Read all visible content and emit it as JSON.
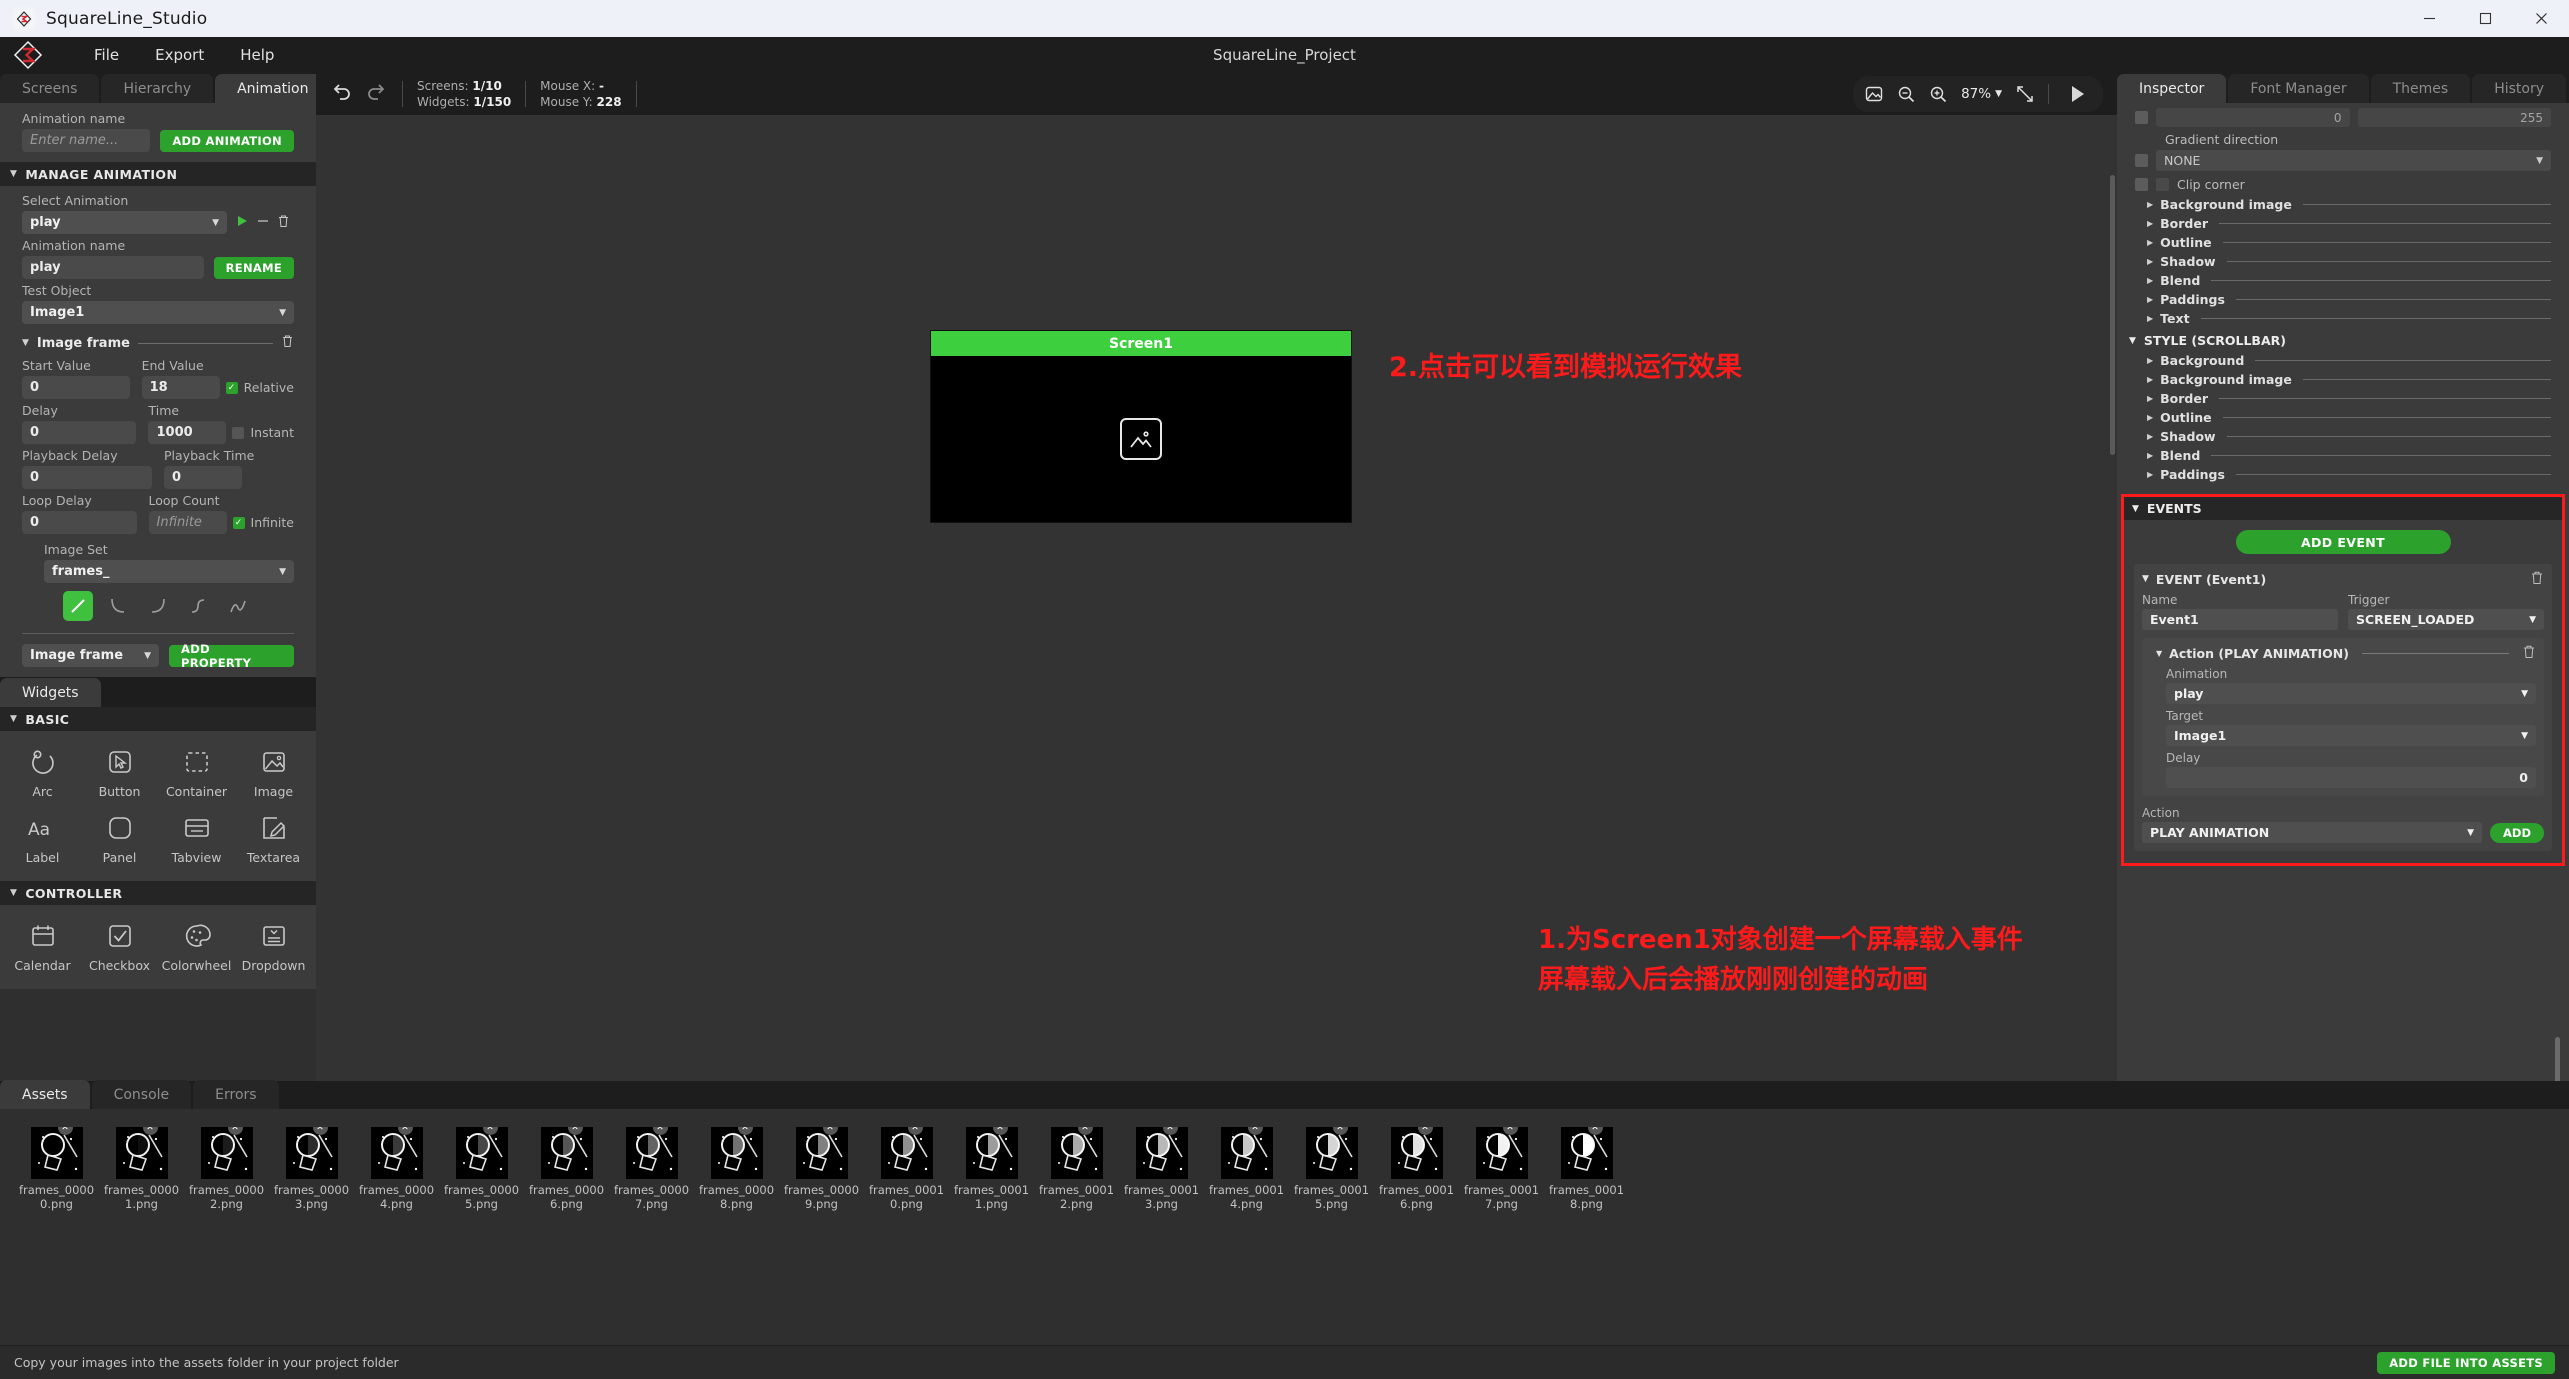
{
  "os": {
    "title": "SquareLine_Studio",
    "minimize": "─",
    "maximize": "❐",
    "close": "✕"
  },
  "menubar": {
    "items": [
      "File",
      "Export",
      "Help"
    ],
    "project_title": "SquareLine_Project"
  },
  "left_panel": {
    "tabs": [
      {
        "label": "Screens",
        "active": false
      },
      {
        "label": "Hierarchy",
        "active": false
      },
      {
        "label": "Animation",
        "active": true
      }
    ],
    "animation_name_label": "Animation name",
    "animation_name_placeholder": "Enter name...",
    "add_animation_button": "ADD ANIMATION",
    "manage_section": "MANAGE ANIMATION",
    "select_animation_label": "Select Animation",
    "select_animation_value": "play",
    "anim_name_label": "Animation name",
    "anim_name_value": "play",
    "rename_button": "RENAME",
    "test_object_label": "Test Object",
    "test_object_value": "Image1",
    "property_group": "Image frame",
    "fields": {
      "start_value_label": "Start Value",
      "start_value": "0",
      "end_value_label": "End Value",
      "end_value": "18",
      "relative_label": "Relative",
      "delay_label": "Delay",
      "delay": "0",
      "time_label": "Time",
      "time": "1000",
      "instant_label": "Instant",
      "playback_delay_label": "Playback Delay",
      "playback_delay": "0",
      "playback_time_label": "Playback Time",
      "playback_time": "0",
      "loop_delay_label": "Loop Delay",
      "loop_delay": "0",
      "loop_count_label": "Loop Count",
      "loop_count": "Infinite",
      "infinite_label": "Infinite",
      "image_set_label": "Image Set",
      "image_set_value": "frames_"
    },
    "property_select": "Image frame",
    "add_property_button": "ADD PROPERTY"
  },
  "widgets_panel": {
    "tab": "Widgets",
    "sections": [
      {
        "title": "BASIC",
        "items": [
          {
            "label": "Arc",
            "icon": "arc-icon"
          },
          {
            "label": "Button",
            "icon": "button-icon"
          },
          {
            "label": "Container",
            "icon": "container-icon"
          },
          {
            "label": "Image",
            "icon": "image-icon"
          },
          {
            "label": "Label",
            "icon": "label-icon"
          },
          {
            "label": "Panel",
            "icon": "panel-icon"
          },
          {
            "label": "Tabview",
            "icon": "tabview-icon"
          },
          {
            "label": "Textarea",
            "icon": "textarea-icon"
          }
        ]
      },
      {
        "title": "CONTROLLER",
        "items": [
          {
            "label": "Calendar",
            "icon": "calendar-icon"
          },
          {
            "label": "Checkbox",
            "icon": "checkbox-icon"
          },
          {
            "label": "Colorwheel",
            "icon": "colorwheel-icon"
          },
          {
            "label": "Dropdown",
            "icon": "dropdown-icon"
          }
        ]
      }
    ]
  },
  "canvas_toolbar": {
    "undo_icon": "undo-icon",
    "redo_icon": "redo-icon",
    "screens_label": "Screens:",
    "screens_value": "1/10",
    "widgets_label": "Widgets:",
    "widgets_value": "1/150",
    "mouse_x_label": "Mouse X:",
    "mouse_x_value": "-",
    "mouse_y_label": "Mouse Y:",
    "mouse_y_value": "228",
    "zoom_value": "87%",
    "play_icon": "play-icon"
  },
  "canvas": {
    "screen_title": "Screen1",
    "note1": [
      "1.为Screen1对象创建一个屏幕载入事件",
      "屏幕载入后会播放刚刚创建的动画"
    ],
    "note2": "2.点击可以看到模拟运行效果"
  },
  "inspector": {
    "tabs": [
      {
        "label": "Inspector",
        "active": true
      },
      {
        "label": "Font Manager",
        "active": false
      },
      {
        "label": "Themes",
        "active": false
      },
      {
        "label": "History",
        "active": false
      }
    ],
    "opacity_min": "0",
    "opacity_max": "255",
    "gradient_direction_label": "Gradient direction",
    "gradient_direction_value": "NONE",
    "clip_corner_label": "Clip corner",
    "style_rows": [
      "Background image",
      "Border",
      "Outline",
      "Shadow",
      "Blend",
      "Paddings",
      "Text"
    ],
    "scrollbar_section": "STYLE (SCROLLBAR)",
    "scrollbar_rows": [
      "Background",
      "Background image",
      "Border",
      "Outline",
      "Shadow",
      "Blend",
      "Paddings"
    ]
  },
  "events": {
    "section_title": "EVENTS",
    "add_event_button": "ADD EVENT",
    "event_header": "EVENT (Event1)",
    "name_label": "Name",
    "name_value": "Event1",
    "trigger_label": "Trigger",
    "trigger_value": "SCREEN_LOADED",
    "action_header": "Action (PLAY ANIMATION)",
    "animation_label": "Animation",
    "animation_value": "play",
    "target_label": "Target",
    "target_value": "Image1",
    "delay_label": "Delay",
    "delay_value": "0",
    "action_label": "Action",
    "action_value": "PLAY ANIMATION",
    "add_button": "ADD",
    "highlight_color": "#ff1b1b"
  },
  "assets": {
    "tabs": [
      {
        "label": "Assets",
        "active": true
      },
      {
        "label": "Console",
        "active": false
      },
      {
        "label": "Errors",
        "active": false
      }
    ],
    "files": [
      "frames_00000.png",
      "frames_00001.png",
      "frames_00002.png",
      "frames_00003.png",
      "frames_00004.png",
      "frames_00005.png",
      "frames_00006.png",
      "frames_00007.png",
      "frames_00008.png",
      "frames_00009.png",
      "frames_00010.png",
      "frames_00011.png",
      "frames_00012.png",
      "frames_00013.png",
      "frames_00014.png",
      "frames_00015.png",
      "frames_00016.png",
      "frames_00017.png",
      "frames_00018.png"
    ]
  },
  "statusbar": {
    "message": "Copy your images into the assets folder in your project folder",
    "add_file_button": "ADD FILE INTO ASSETS"
  }
}
